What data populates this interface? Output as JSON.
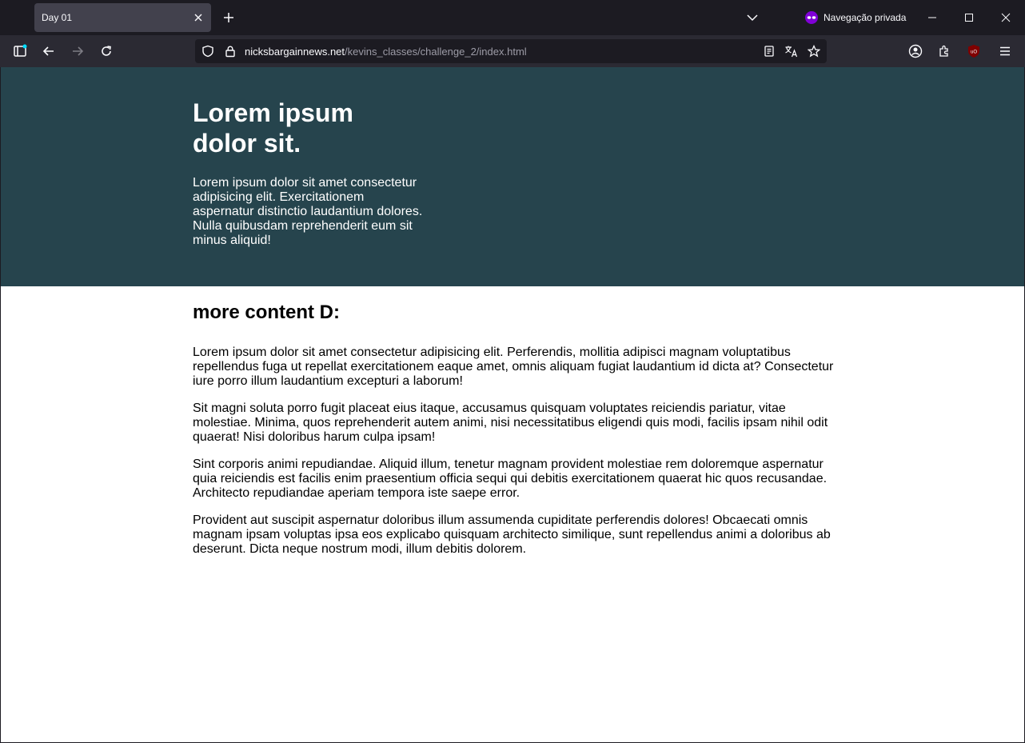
{
  "browser": {
    "tab_title": "Day 01",
    "private_label": "Navegação privada",
    "url_domain": "nicksbargainnews.net",
    "url_path": "/kevins_classes/challenge_2/index.html",
    "private_color": "#8000d7",
    "ublock_color": "#800000"
  },
  "page": {
    "hero_title": "Lorem ipsum dolor sit.",
    "hero_text": "Lorem ipsum dolor sit amet consectetur adipisicing elit. Exercitationem aspernatur distinctio laudantium dolores. Nulla quibusdam reprehenderit eum sit minus aliquid!",
    "hero_bg": "#26444d",
    "section_heading": "more content D:",
    "paragraphs": [
      "Lorem ipsum dolor sit amet consectetur adipisicing elit. Perferendis, mollitia adipisci magnam voluptatibus repellendus fuga ut repellat exercitationem eaque amet, omnis aliquam fugiat laudantium id dicta at? Consectetur iure porro illum laudantium excepturi a laborum!",
      "Sit magni soluta porro fugit placeat eius itaque, accusamus quisquam voluptates reiciendis pariatur, vitae molestiae. Minima, quos reprehenderit autem animi, nisi necessitatibus eligendi quis modi, facilis ipsam nihil odit quaerat! Nisi doloribus harum culpa ipsam!",
      "Sint corporis animi repudiandae. Aliquid illum, tenetur magnam provident molestiae rem doloremque aspernatur quia reiciendis est facilis enim praesentium officia sequi qui debitis exercitationem quaerat hic quos recusandae. Architecto repudiandae aperiam tempora iste saepe error.",
      "Provident aut suscipit aspernatur doloribus illum assumenda cupiditate perferendis dolores! Obcaecati omnis magnam ipsam voluptas ipsa eos explicabo quisquam architecto similique, sunt repellendus animi a doloribus ab deserunt. Dicta neque nostrum modi, illum debitis dolorem."
    ]
  }
}
